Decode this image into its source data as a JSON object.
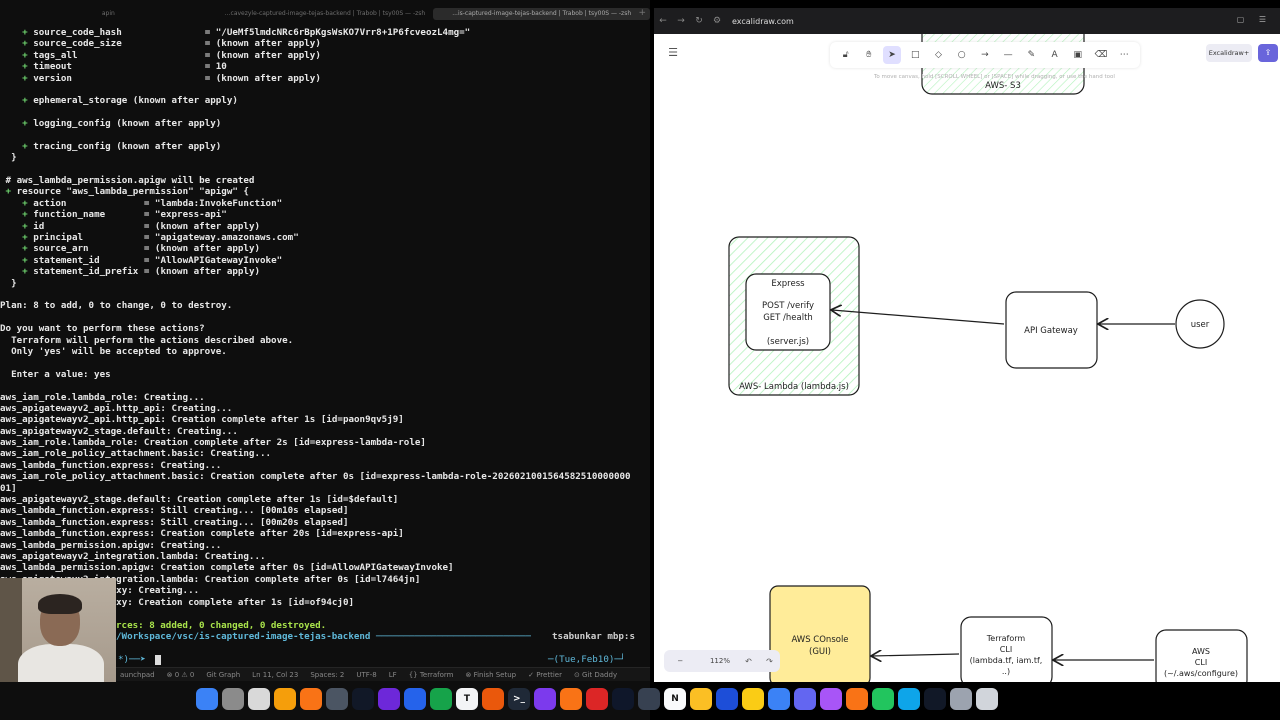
{
  "terminal": {
    "tabs": [
      "apin",
      "...cavezyle-captured-image-tejas-backend | Trabob | tsy00S — -zsh",
      "...is-captured-image-tejas-backend | Trabob | tsy00S — -zsh"
    ],
    "lines": [
      {
        "t": "    + source_code_hash               = \"/UeMf5lmdcNRc6rBpKgsWsKO7Vrr8+1P6fcveozL4mg=\""
      },
      {
        "t": "    + source_code_size               = (known after apply)"
      },
      {
        "t": "    + tags_all                       = (known after apply)"
      },
      {
        "t": "    + timeout                        = 10"
      },
      {
        "t": "    + version                        = (known after apply)"
      },
      {
        "t": ""
      },
      {
        "t": "    + ephemeral_storage (known after apply)"
      },
      {
        "t": ""
      },
      {
        "t": "    + logging_config (known after apply)"
      },
      {
        "t": ""
      },
      {
        "t": "    + tracing_config (known after apply)"
      },
      {
        "t": "  }"
      },
      {
        "t": ""
      },
      {
        "t": " # aws_lambda_permission.apigw will be created"
      },
      {
        "t": " + resource \"aws_lambda_permission\" \"apigw\" {"
      },
      {
        "t": "    + action              = \"lambda:InvokeFunction\""
      },
      {
        "t": "    + function_name       = \"express-api\""
      },
      {
        "t": "    + id                  = (known after apply)"
      },
      {
        "t": "    + principal           = \"apigateway.amazonaws.com\""
      },
      {
        "t": "    + source_arn          = (known after apply)"
      },
      {
        "t": "    + statement_id        = \"AllowAPIGatewayInvoke\""
      },
      {
        "t": "    + statement_id_prefix = (known after apply)"
      },
      {
        "t": "  }"
      },
      {
        "t": ""
      },
      {
        "t": "Plan: 8 to add, 0 to change, 0 to destroy."
      },
      {
        "t": ""
      },
      {
        "t": "Do you want to perform these actions?"
      },
      {
        "t": "  Terraform will perform the actions described above."
      },
      {
        "t": "  Only 'yes' will be accepted to approve."
      },
      {
        "t": ""
      },
      {
        "t": "  Enter a value: yes"
      },
      {
        "t": ""
      },
      {
        "t": "aws_iam_role.lambda_role: Creating..."
      },
      {
        "t": "aws_apigatewayv2_api.http_api: Creating..."
      },
      {
        "t": "aws_apigatewayv2_api.http_api: Creation complete after 1s [id=paon9qv5j9]"
      },
      {
        "t": "aws_apigatewayv2_stage.default: Creating..."
      },
      {
        "t": "aws_iam_role.lambda_role: Creation complete after 2s [id=express-lambda-role]"
      },
      {
        "t": "aws_iam_role_policy_attachment.basic: Creating..."
      },
      {
        "t": "aws_lambda_function.express: Creating..."
      },
      {
        "t": "aws_iam_role_policy_attachment.basic: Creation complete after 0s [id=express-lambda-role-2026021001564582510000000"
      },
      {
        "t": "01]"
      },
      {
        "t": "aws_apigatewayv2_stage.default: Creation complete after 1s [id=$default]"
      },
      {
        "t": "aws_lambda_function.express: Still creating... [00m10s elapsed]"
      },
      {
        "t": "aws_lambda_function.express: Still creating... [00m20s elapsed]"
      },
      {
        "t": "aws_lambda_function.express: Creation complete after 20s [id=express-api]"
      },
      {
        "t": "aws_lambda_permission.apigw: Creating..."
      },
      {
        "t": "aws_apigatewayv2_integration.lambda: Creating..."
      },
      {
        "t": "aws_lambda_permission.apigw: Creation complete after 0s [id=AllowAPIGatewayInvoke]"
      },
      {
        "t": "aws_apigatewayv2_integration.lambda: Creation complete after 0s [id=l7464jn]"
      },
      {
        "t": "                e.proxy: Creating..."
      },
      {
        "t": "                e.proxy: Creation complete after 1s [id=of94cj0]"
      }
    ],
    "summary": "rces: 8 added, 0 changed, 0 destroyed.",
    "prompt_path": "/Workspace/vsc/is-captured-image-tejas-backend ────────────────────────────",
    "prompt_user": "tsabunkar mbp:s",
    "prompt_arrow": "*)──➤",
    "prompt_date": "─(Tue,Feb10)─┘",
    "statusbar": [
      "aunchpad",
      "⊗ 0 ⚠ 0",
      "Git Graph",
      "Ln 11, Col 23",
      "Spaces: 2",
      "UTF-8",
      "LF",
      "{} Terraform",
      "⊗ Finish Setup",
      "✓ Prettier",
      "⊙ Git Daddy"
    ]
  },
  "browser": {
    "url": "excalidraw.com",
    "library_label": "Excalidraw+",
    "hint": "To move canvas, hold [SCROLL WHEEL] or [SPACE] while dragging, or use the hand tool",
    "zoom": "112%"
  },
  "diagram": {
    "s3_label": "AWS- S3",
    "express_title": "Express",
    "express_routes": [
      "POST /verify",
      "GET /health"
    ],
    "express_file": "(server.js)",
    "lambda_label": "AWS- Lambda (lambda.js)",
    "api_gateway": "API Gateway",
    "user": "user",
    "console": [
      "AWS COnsole",
      "(GUI)"
    ],
    "terraform": [
      "Terraform",
      "CLI",
      "(lambda.tf, iam.tf,",
      "..)"
    ],
    "aws_cli": [
      "AWS",
      "CLI",
      "(~/.aws/configure)"
    ]
  },
  "colors": {
    "terminal_bg": "#0e0e0e",
    "terminal_green": "#a9e34b",
    "terminal_cyan": "#5fb8d9",
    "excalidraw_accent": "#6965db",
    "console_fill": "#ffec99",
    "lambda_hatch": "#b2f2bb"
  }
}
